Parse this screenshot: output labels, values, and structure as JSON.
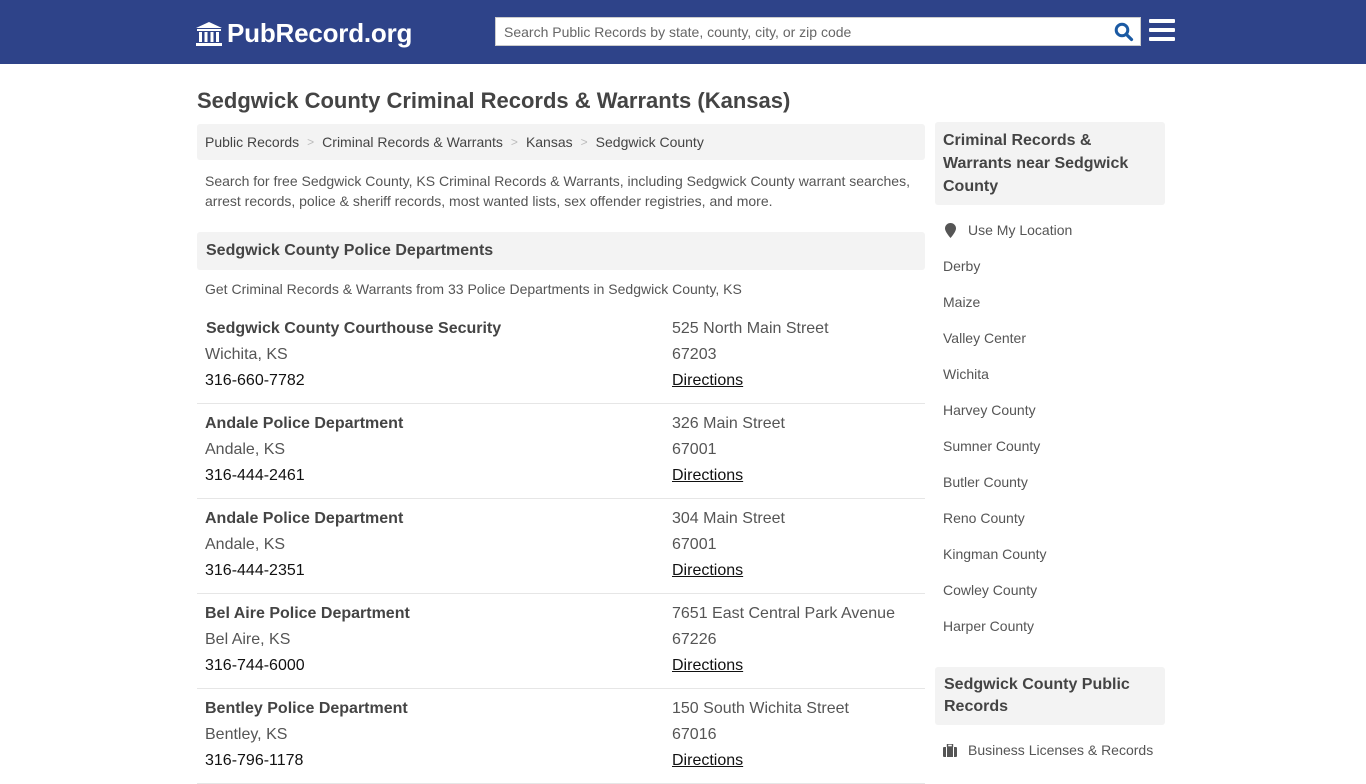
{
  "header": {
    "logo_text": "PubRecord.org",
    "search_placeholder": "Search Public Records by state, county, city, or zip code",
    "brand_color": "#2e4389",
    "accent_color": "#1b5aa3"
  },
  "page": {
    "title": "Sedgwick County Criminal Records & Warrants (Kansas)",
    "breadcrumb": [
      "Public Records",
      "Criminal Records & Warrants",
      "Kansas",
      "Sedgwick County"
    ],
    "intro": "Search for free Sedgwick County, KS Criminal Records & Warrants, including Sedgwick County warrant searches, arrest records, police & sheriff records, most wanted lists, sex offender registries, and more."
  },
  "section": {
    "title": "Sedgwick County Police Departments",
    "subtitle": "Get Criminal Records & Warrants from 33 Police Departments in Sedgwick County, KS",
    "directions_label": "Directions",
    "departments": [
      {
        "name": "Sedgwick County Courthouse Security",
        "city": "Wichita, KS",
        "phone": "316-660-7782",
        "address": "525 North Main Street",
        "zip": "67203"
      },
      {
        "name": "Andale Police Department",
        "city": "Andale, KS",
        "phone": "316-444-2461",
        "address": "326 Main Street",
        "zip": "67001"
      },
      {
        "name": "Andale Police Department",
        "city": "Andale, KS",
        "phone": "316-444-2351",
        "address": "304 Main Street",
        "zip": "67001"
      },
      {
        "name": "Bel Aire Police Department",
        "city": "Bel Aire, KS",
        "phone": "316-744-6000",
        "address": "7651 East Central Park Avenue",
        "zip": "67226"
      },
      {
        "name": "Bentley Police Department",
        "city": "Bentley, KS",
        "phone": "316-796-1178",
        "address": "150 South Wichita Street",
        "zip": "67016"
      }
    ]
  },
  "sidebar": {
    "nearby_title": "Criminal Records & Warrants near Sedgwick County",
    "use_location": "Use My Location",
    "nearby": [
      "Derby",
      "Maize",
      "Valley Center",
      "Wichita",
      "Harvey County",
      "Sumner County",
      "Butler County",
      "Reno County",
      "Kingman County",
      "Cowley County",
      "Harper County"
    ],
    "public_records_title": "Sedgwick County Public Records",
    "public_records": [
      {
        "label": "Business Licenses & Records",
        "icon": "briefcase-icon"
      }
    ]
  }
}
